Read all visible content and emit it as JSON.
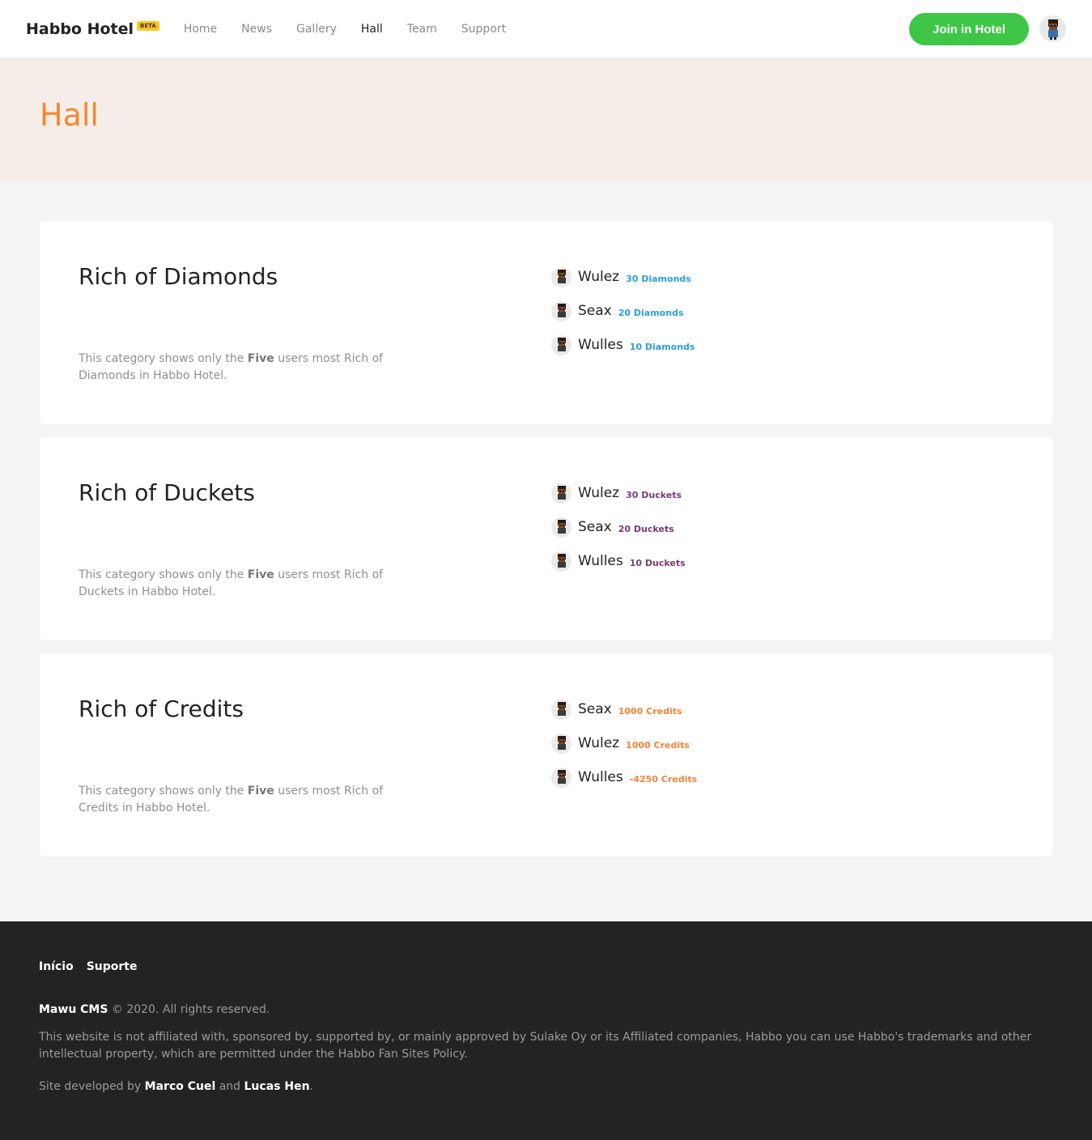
{
  "header": {
    "brand": "Habbo Hotel",
    "badge": "BETA",
    "nav": [
      {
        "label": "Home"
      },
      {
        "label": "News"
      },
      {
        "label": "Gallery"
      },
      {
        "label": "Hall"
      },
      {
        "label": "Team"
      },
      {
        "label": "Support"
      }
    ],
    "active_nav": "Hall",
    "join_button": "Join in Hotel",
    "avatar_icon": "user-avatar-icon"
  },
  "hero": {
    "title": "Hall"
  },
  "categories": [
    {
      "title": "Rich of Diamonds",
      "desc_pre": "This category shows only the ",
      "desc_bold": "Five",
      "desc_post": " users most Rich of Diamonds in Habbo Hotel.",
      "color": "#2b9fd9",
      "entries": [
        {
          "name": "Wulez",
          "value": "30 Diamonds"
        },
        {
          "name": "Seax",
          "value": "20 Diamonds"
        },
        {
          "name": "Wulles",
          "value": "10 Diamonds"
        }
      ]
    },
    {
      "title": "Rich of Duckets",
      "desc_pre": "This category shows only the ",
      "desc_bold": "Five",
      "desc_post": " users most Rich of Duckets in Habbo Hotel.",
      "color": "#7a3a72",
      "entries": [
        {
          "name": "Wulez",
          "value": "30 Duckets"
        },
        {
          "name": "Seax",
          "value": "20 Duckets"
        },
        {
          "name": "Wulles",
          "value": "10 Duckets"
        }
      ]
    },
    {
      "title": "Rich of Credits",
      "desc_pre": "This category shows only the ",
      "desc_bold": "Five",
      "desc_post": " users most Rich of Credits in Habbo Hotel.",
      "color": "#f0843a",
      "entries": [
        {
          "name": "Seax",
          "value": "1000 Credits"
        },
        {
          "name": "Wulez",
          "value": "1000 Credits"
        },
        {
          "name": "Wulles",
          "value": "-4250 Credits"
        }
      ]
    }
  ],
  "footer": {
    "links": [
      {
        "label": "Início"
      },
      {
        "label": "Suporte"
      }
    ],
    "brand": "Mawu CMS",
    "copyright": " © 2020. All rights reserved.",
    "disclaimer": "This website is not affiliated with, sponsored by, supported by, or mainly approved by Sulake Oy or its Affiliated companies, Habbo you can use Habbo's trademarks and other intellectual property, which are permitted under the Habbo Fan Sites Policy.",
    "dev_pre": "Site developed by ",
    "dev_1": "Marco Cuel",
    "dev_mid": " and ",
    "dev_2": "Lucas Hen",
    "dev_post": "."
  }
}
